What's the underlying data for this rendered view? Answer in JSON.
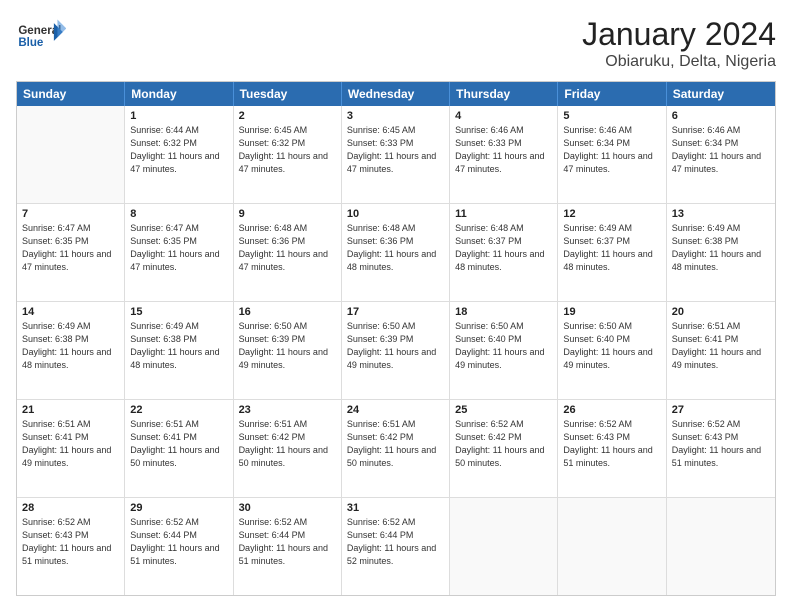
{
  "header": {
    "logo_general": "General",
    "logo_blue": "Blue",
    "title": "January 2024",
    "subtitle": "Obiaruku, Delta, Nigeria"
  },
  "calendar": {
    "days": [
      "Sunday",
      "Monday",
      "Tuesday",
      "Wednesday",
      "Thursday",
      "Friday",
      "Saturday"
    ],
    "weeks": [
      [
        {
          "date": "",
          "empty": true
        },
        {
          "date": "1",
          "sunrise": "6:44 AM",
          "sunset": "6:32 PM",
          "daylight": "11 hours and 47 minutes."
        },
        {
          "date": "2",
          "sunrise": "6:45 AM",
          "sunset": "6:32 PM",
          "daylight": "11 hours and 47 minutes."
        },
        {
          "date": "3",
          "sunrise": "6:45 AM",
          "sunset": "6:33 PM",
          "daylight": "11 hours and 47 minutes."
        },
        {
          "date": "4",
          "sunrise": "6:46 AM",
          "sunset": "6:33 PM",
          "daylight": "11 hours and 47 minutes."
        },
        {
          "date": "5",
          "sunrise": "6:46 AM",
          "sunset": "6:34 PM",
          "daylight": "11 hours and 47 minutes."
        },
        {
          "date": "6",
          "sunrise": "6:46 AM",
          "sunset": "6:34 PM",
          "daylight": "11 hours and 47 minutes."
        }
      ],
      [
        {
          "date": "7",
          "sunrise": "6:47 AM",
          "sunset": "6:35 PM",
          "daylight": "11 hours and 47 minutes."
        },
        {
          "date": "8",
          "sunrise": "6:47 AM",
          "sunset": "6:35 PM",
          "daylight": "11 hours and 47 minutes."
        },
        {
          "date": "9",
          "sunrise": "6:48 AM",
          "sunset": "6:36 PM",
          "daylight": "11 hours and 47 minutes."
        },
        {
          "date": "10",
          "sunrise": "6:48 AM",
          "sunset": "6:36 PM",
          "daylight": "11 hours and 48 minutes."
        },
        {
          "date": "11",
          "sunrise": "6:48 AM",
          "sunset": "6:37 PM",
          "daylight": "11 hours and 48 minutes."
        },
        {
          "date": "12",
          "sunrise": "6:49 AM",
          "sunset": "6:37 PM",
          "daylight": "11 hours and 48 minutes."
        },
        {
          "date": "13",
          "sunrise": "6:49 AM",
          "sunset": "6:38 PM",
          "daylight": "11 hours and 48 minutes."
        }
      ],
      [
        {
          "date": "14",
          "sunrise": "6:49 AM",
          "sunset": "6:38 PM",
          "daylight": "11 hours and 48 minutes."
        },
        {
          "date": "15",
          "sunrise": "6:49 AM",
          "sunset": "6:38 PM",
          "daylight": "11 hours and 48 minutes."
        },
        {
          "date": "16",
          "sunrise": "6:50 AM",
          "sunset": "6:39 PM",
          "daylight": "11 hours and 49 minutes."
        },
        {
          "date": "17",
          "sunrise": "6:50 AM",
          "sunset": "6:39 PM",
          "daylight": "11 hours and 49 minutes."
        },
        {
          "date": "18",
          "sunrise": "6:50 AM",
          "sunset": "6:40 PM",
          "daylight": "11 hours and 49 minutes."
        },
        {
          "date": "19",
          "sunrise": "6:50 AM",
          "sunset": "6:40 PM",
          "daylight": "11 hours and 49 minutes."
        },
        {
          "date": "20",
          "sunrise": "6:51 AM",
          "sunset": "6:41 PM",
          "daylight": "11 hours and 49 minutes."
        }
      ],
      [
        {
          "date": "21",
          "sunrise": "6:51 AM",
          "sunset": "6:41 PM",
          "daylight": "11 hours and 49 minutes."
        },
        {
          "date": "22",
          "sunrise": "6:51 AM",
          "sunset": "6:41 PM",
          "daylight": "11 hours and 50 minutes."
        },
        {
          "date": "23",
          "sunrise": "6:51 AM",
          "sunset": "6:42 PM",
          "daylight": "11 hours and 50 minutes."
        },
        {
          "date": "24",
          "sunrise": "6:51 AM",
          "sunset": "6:42 PM",
          "daylight": "11 hours and 50 minutes."
        },
        {
          "date": "25",
          "sunrise": "6:52 AM",
          "sunset": "6:42 PM",
          "daylight": "11 hours and 50 minutes."
        },
        {
          "date": "26",
          "sunrise": "6:52 AM",
          "sunset": "6:43 PM",
          "daylight": "11 hours and 51 minutes."
        },
        {
          "date": "27",
          "sunrise": "6:52 AM",
          "sunset": "6:43 PM",
          "daylight": "11 hours and 51 minutes."
        }
      ],
      [
        {
          "date": "28",
          "sunrise": "6:52 AM",
          "sunset": "6:43 PM",
          "daylight": "11 hours and 51 minutes."
        },
        {
          "date": "29",
          "sunrise": "6:52 AM",
          "sunset": "6:44 PM",
          "daylight": "11 hours and 51 minutes."
        },
        {
          "date": "30",
          "sunrise": "6:52 AM",
          "sunset": "6:44 PM",
          "daylight": "11 hours and 51 minutes."
        },
        {
          "date": "31",
          "sunrise": "6:52 AM",
          "sunset": "6:44 PM",
          "daylight": "11 hours and 52 minutes."
        },
        {
          "date": "",
          "empty": true
        },
        {
          "date": "",
          "empty": true
        },
        {
          "date": "",
          "empty": true
        }
      ]
    ]
  }
}
